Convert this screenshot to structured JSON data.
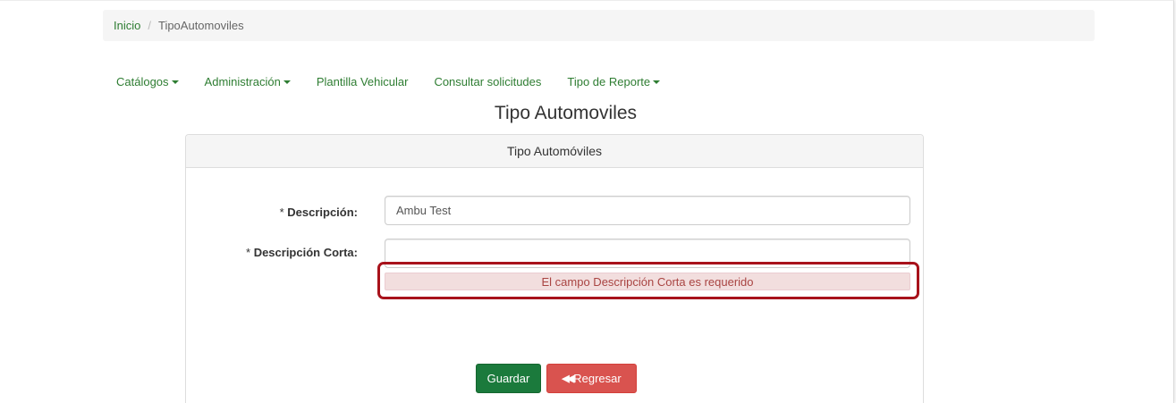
{
  "breadcrumb": {
    "home": "Inicio",
    "separator": "/",
    "current": "TipoAutomoviles"
  },
  "nav": {
    "catalogos": "Catálogos",
    "administracion": "Administración",
    "plantilla": "Plantilla Vehicular",
    "consultar": "Consultar solicitudes",
    "reporte": "Tipo de Reporte"
  },
  "page": {
    "title": "Tipo Automoviles"
  },
  "panel": {
    "heading": "Tipo Automóviles",
    "descripcion_label": "Descripción:",
    "descripcion_value": "Ambu Test",
    "corta_label": "Descripción Corta:",
    "corta_value": "",
    "required_mark": "*",
    "error": "El campo Descripción Corta es requerido"
  },
  "buttons": {
    "save": "Guardar",
    "back_icon": "double-left-chevron-icon",
    "back": "Regresar"
  },
  "colors": {
    "link_green": "#2e7d32",
    "save_green": "#1b7a3c",
    "back_red": "#d9534f",
    "error_text": "#a94442",
    "highlight": "#a8121b"
  }
}
